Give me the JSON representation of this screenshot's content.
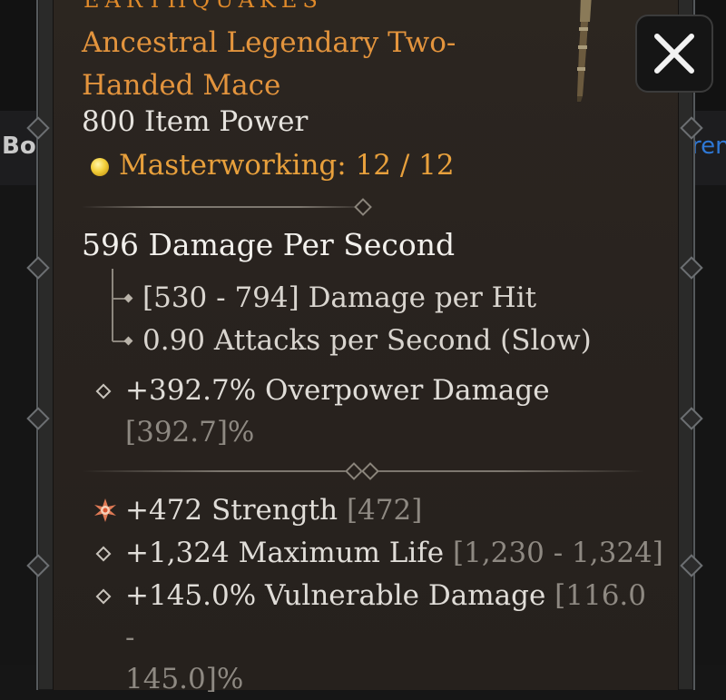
{
  "background": {
    "left_text": "Bo",
    "right_text": "ren"
  },
  "item": {
    "name_partial": "EARTHQUAKES",
    "type_line": "Ancestral Legendary Two-Handed Mace",
    "item_power": "800 Item Power",
    "masterworking": "Masterworking: 12 / 12",
    "dps": "596 Damage Per Second",
    "damage_per_hit": "[530 - 794] Damage per Hit",
    "attack_speed": "0.90 Attacks per Second (Slow)",
    "implicit": {
      "value": "+392.7% Overpower Damage",
      "range": "[392.7]%"
    },
    "affixes": [
      {
        "icon": "greater-affix-star-icon",
        "value": "+472 Strength",
        "range": "[472]"
      },
      {
        "icon": "diamond-bullet-icon",
        "value": "+1,324 Maximum Life",
        "range": "[1,230 - 1,324]"
      },
      {
        "icon": "diamond-bullet-icon",
        "value": "+145.0% Vulnerable Damage",
        "range_part1": "[116.0 -",
        "range_part2": "145.0]%"
      }
    ]
  },
  "colors": {
    "legendary_orange": "#e3943d",
    "panel_bg": "#29231f",
    "masterwork_gold": "#f3cf3a"
  }
}
